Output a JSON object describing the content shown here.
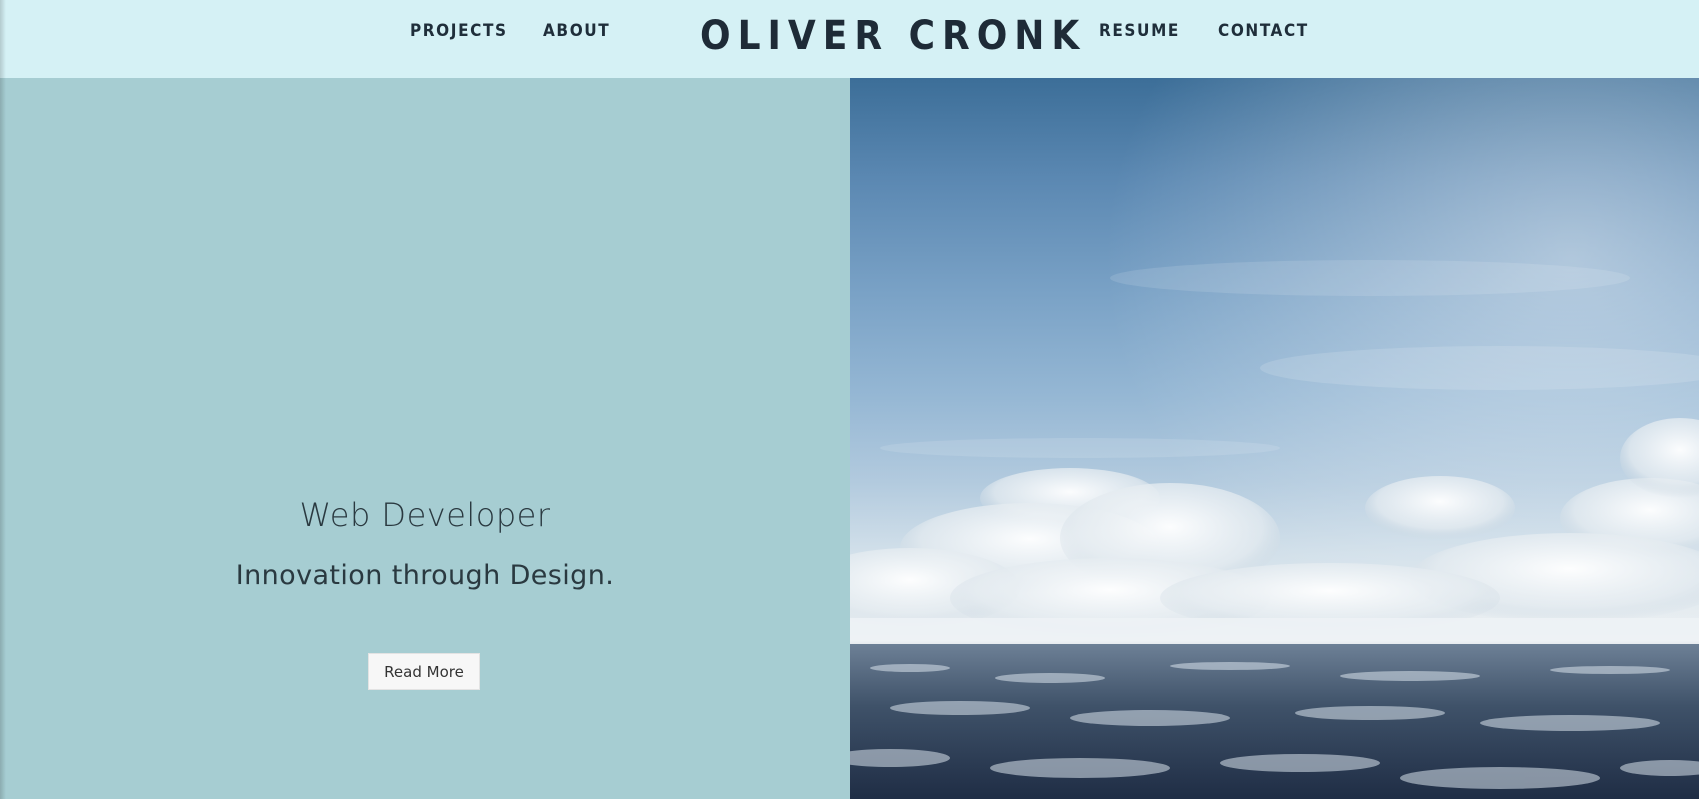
{
  "header": {
    "brand": "OLIVER CRONK",
    "nav_left": [
      "PROJECTS",
      "ABOUT"
    ],
    "nav_right": [
      "RESUME",
      "CONTACT"
    ]
  },
  "hero": {
    "title": "Web Developer",
    "tagline": "Innovation through Design.",
    "button_label": "Read More"
  },
  "image": {
    "subject": "sky-over-sea-photo"
  },
  "colors": {
    "header_bg": "#d5f1f5",
    "panel_bg": "#a6cdd2",
    "text_dark": "#1f2e3a",
    "button_bg": "#f7f7f7"
  }
}
